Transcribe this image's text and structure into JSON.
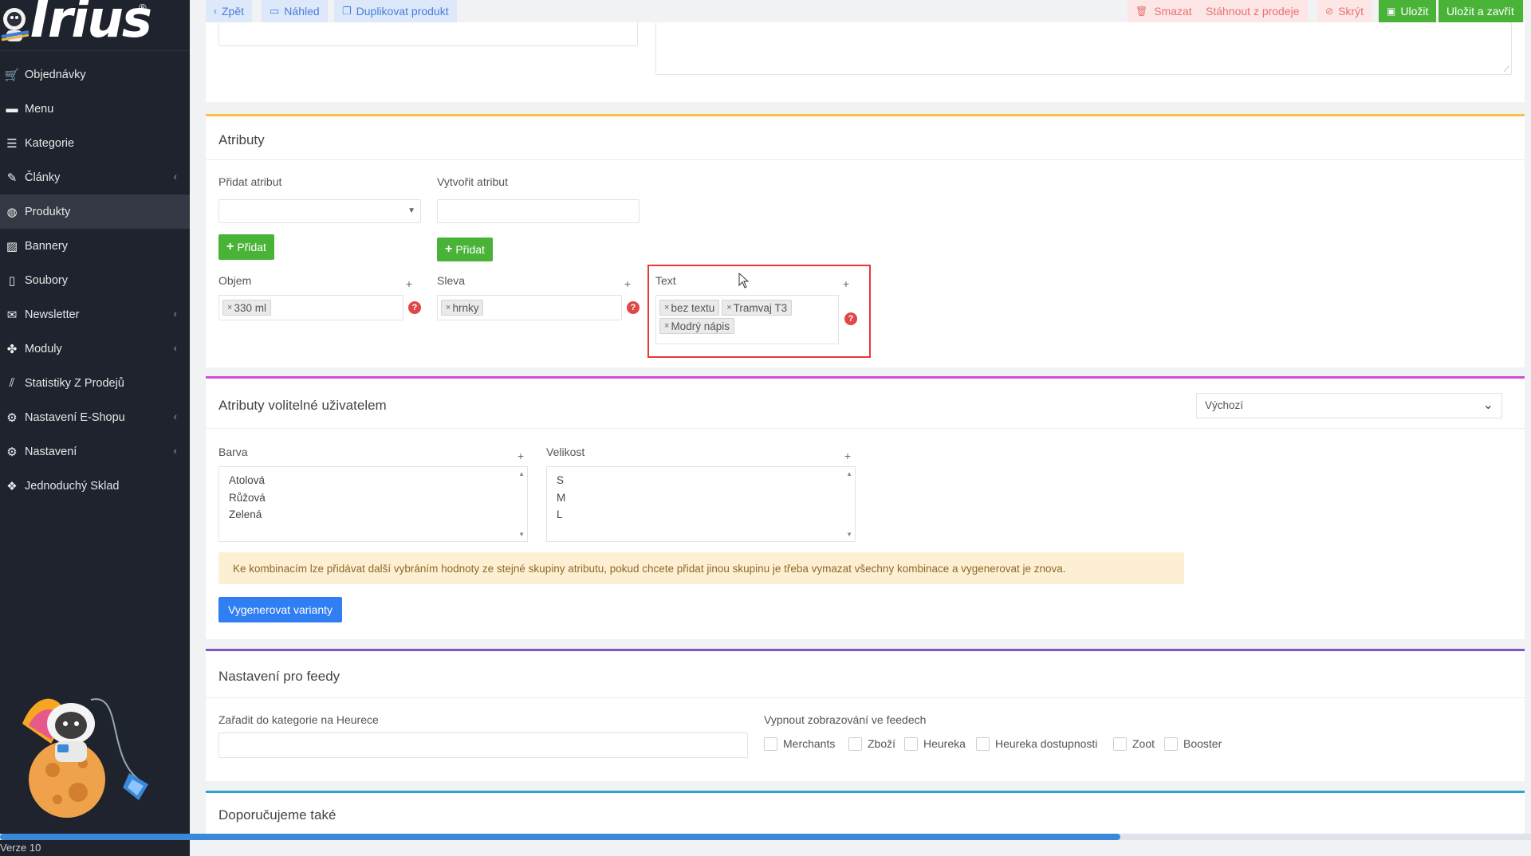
{
  "app": {
    "logo_text": "Irius",
    "version": "Verze 10",
    "progress_fraction": 0.732
  },
  "sidebar": {
    "items": [
      {
        "label": "Objednávky",
        "icon": "cart-icon",
        "active": false,
        "chevron": false
      },
      {
        "label": "Menu",
        "icon": "folder-icon",
        "active": false,
        "chevron": false
      },
      {
        "label": "Kategorie",
        "icon": "list-icon",
        "active": false,
        "chevron": false
      },
      {
        "label": "Články",
        "icon": "pencil-icon",
        "active": false,
        "chevron": true
      },
      {
        "label": "Produkty",
        "icon": "globe-icon",
        "active": true,
        "chevron": false
      },
      {
        "label": "Bannery",
        "icon": "image-icon",
        "active": false,
        "chevron": false
      },
      {
        "label": "Soubory",
        "icon": "file-icon",
        "active": false,
        "chevron": false
      },
      {
        "label": "Newsletter",
        "icon": "envelope-icon",
        "active": false,
        "chevron": true
      },
      {
        "label": "Moduly",
        "icon": "puzzle-icon",
        "active": false,
        "chevron": true
      },
      {
        "label": "Statistiky Z Prodejů",
        "icon": "chart-icon",
        "active": false,
        "chevron": false
      },
      {
        "label": "Nastavení E-Shopu",
        "icon": "cogs-icon",
        "active": false,
        "chevron": true
      },
      {
        "label": "Nastavení",
        "icon": "cogs-icon",
        "active": false,
        "chevron": true
      },
      {
        "label": "Jednoduchý Sklad",
        "icon": "boxes-icon",
        "active": false,
        "chevron": false
      }
    ]
  },
  "toolbar": {
    "back": "Zpět",
    "preview": "Náhled",
    "duplicate": "Duplikovat produkt",
    "delete": "Smazat",
    "withdraw": "Stáhnout z prodeje",
    "hide": "Skrýt",
    "save": "Uložit",
    "save_close": "Uložit a zavřít"
  },
  "attributes": {
    "title": "Atributy",
    "add_label": "Přidat atribut",
    "create_label": "Vytvořit atribut",
    "add_button": "Přidat",
    "create_button": "Přidat",
    "groups": [
      {
        "label": "Objem",
        "tags": [
          "330 ml"
        ]
      },
      {
        "label": "Sleva",
        "tags": [
          "hrnky"
        ]
      },
      {
        "label": "Text",
        "tags": [
          "bez textu",
          "Tramvaj T3",
          "Modrý nápis"
        ]
      }
    ]
  },
  "user_attributes": {
    "title": "Atributy volitelné uživatelem",
    "select_value": "Výchozí",
    "color_label": "Barva",
    "colors": [
      "Atolová",
      "Růžová",
      "Zelená"
    ],
    "size_label": "Velikost",
    "sizes": [
      "S",
      "M",
      "L"
    ],
    "notice": "Ke kombinacím lze přidávat další vybráním hodnoty ze stejné skupiny atributu, pokud chcete přidat jinou skupinu je třeba vymazat všechny kombinace a vygenerovat je znova.",
    "generate_button": "Vygenerovat varianty"
  },
  "feeds": {
    "title": "Nastavení pro feedy",
    "heureka_category_label": "Zařadit do kategorie na Heurece",
    "disable_label": "Vypnout zobrazování ve feedech",
    "options": [
      "Merchants",
      "Zboží",
      "Heureka",
      "Heureka dostupnosti",
      "Zoot",
      "Booster"
    ]
  },
  "recommended": {
    "title": "Doporučujeme také"
  },
  "colors": {
    "sidebar_bg": "#1f232d",
    "accent_green": "#49b338",
    "accent_blue": "#2f7ef2",
    "highlight_red": "#e53935",
    "attributes_border": "#f5c343",
    "user_attr_border": "#d24bd8",
    "feeds_border": "#7e57c2",
    "recommended_border": "#2fa3d6"
  }
}
